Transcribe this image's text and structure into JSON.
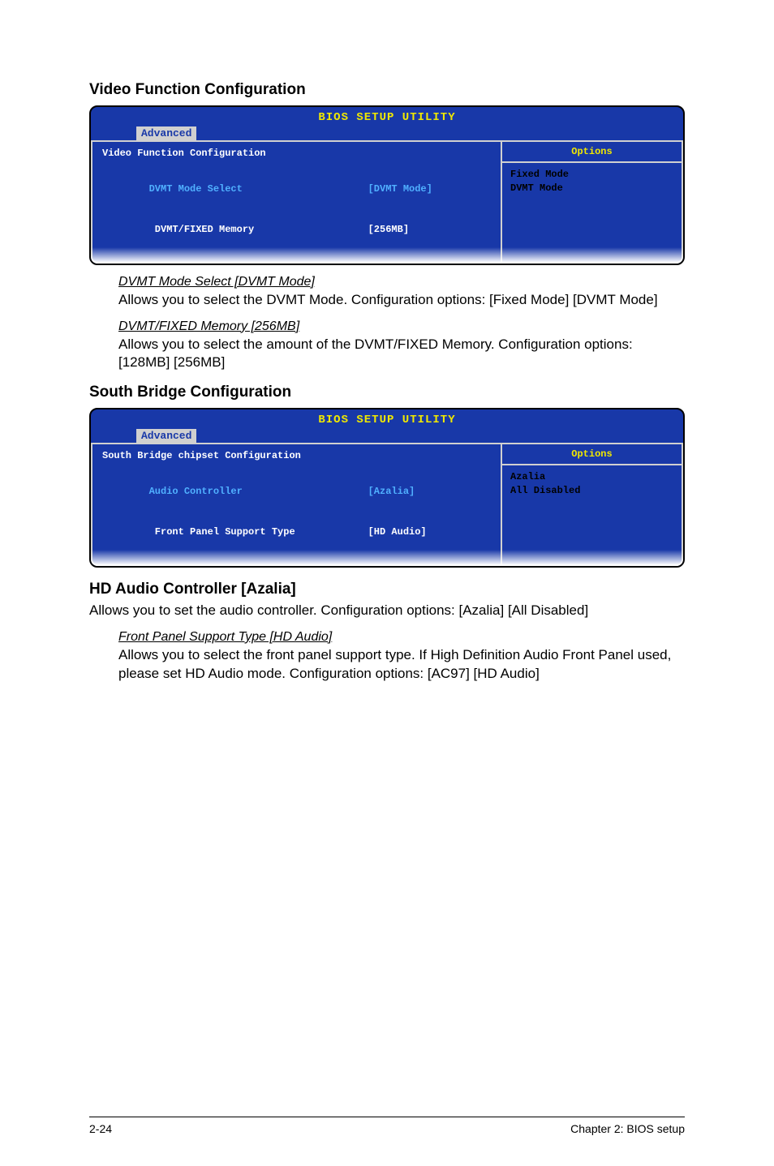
{
  "section1": {
    "heading": "Video Function Configuration",
    "bios": {
      "title": "BIOS SETUP UTILITY",
      "tab": "Advanced",
      "panel_title": "Video Function Configuration",
      "row1_label": "DVMT Mode Select",
      "row1_value": "[DVMT Mode]",
      "row2_label": " DVMT/FIXED Memory",
      "row2_value": "[256MB]",
      "options_header": "Options",
      "option1": "Fixed Mode",
      "option2": "DVMT Mode"
    },
    "sub1": {
      "title": "DVMT Mode Select [DVMT Mode]",
      "text": "Allows you to select the DVMT Mode. Configuration options: [Fixed Mode] [DVMT Mode]"
    },
    "sub2": {
      "title": "DVMT/FIXED Memory [256MB]",
      "text": "Allows you to select the amount of the DVMT/FIXED Memory. Configuration options: [128MB] [256MB]"
    }
  },
  "section2": {
    "heading": "South Bridge Configuration",
    "bios": {
      "title": "BIOS SETUP UTILITY",
      "tab": "Advanced",
      "panel_title": "South Bridge chipset Configuration",
      "row1_label": "Audio Controller",
      "row1_value": "[Azalia]",
      "row2_label": " Front Panel Support Type",
      "row2_value": "[HD Audio]",
      "options_header": "Options",
      "option1": "Azalia",
      "option2": "All Disabled"
    }
  },
  "section3": {
    "heading": "HD Audio Controller [Azalia]",
    "text": "Allows you to set the audio controller. Configuration options: [Azalia] [All Disabled]",
    "sub1": {
      "title": " Front Panel Support Type [HD Audio]",
      "text": "Allows you to select the front panel support type. If High Definition Audio Front Panel used, please set HD Audio mode. Configuration options: [AC97] [HD Audio]"
    }
  },
  "footer": {
    "left": "2-24",
    "right": "Chapter 2: BIOS setup"
  }
}
